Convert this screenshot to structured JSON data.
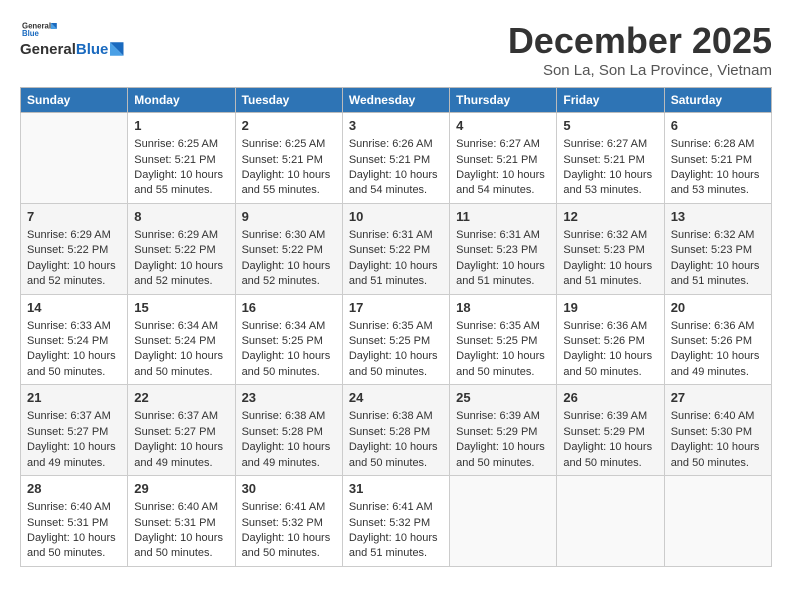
{
  "header": {
    "logo_general": "General",
    "logo_blue": "Blue",
    "month_title": "December 2025",
    "location": "Son La, Son La Province, Vietnam"
  },
  "weekdays": [
    "Sunday",
    "Monday",
    "Tuesday",
    "Wednesday",
    "Thursday",
    "Friday",
    "Saturday"
  ],
  "weeks": [
    [
      {
        "day": "",
        "sunrise": "",
        "sunset": "",
        "daylight": ""
      },
      {
        "day": "1",
        "sunrise": "Sunrise: 6:25 AM",
        "sunset": "Sunset: 5:21 PM",
        "daylight": "Daylight: 10 hours and 55 minutes."
      },
      {
        "day": "2",
        "sunrise": "Sunrise: 6:25 AM",
        "sunset": "Sunset: 5:21 PM",
        "daylight": "Daylight: 10 hours and 55 minutes."
      },
      {
        "day": "3",
        "sunrise": "Sunrise: 6:26 AM",
        "sunset": "Sunset: 5:21 PM",
        "daylight": "Daylight: 10 hours and 54 minutes."
      },
      {
        "day": "4",
        "sunrise": "Sunrise: 6:27 AM",
        "sunset": "Sunset: 5:21 PM",
        "daylight": "Daylight: 10 hours and 54 minutes."
      },
      {
        "day": "5",
        "sunrise": "Sunrise: 6:27 AM",
        "sunset": "Sunset: 5:21 PM",
        "daylight": "Daylight: 10 hours and 53 minutes."
      },
      {
        "day": "6",
        "sunrise": "Sunrise: 6:28 AM",
        "sunset": "Sunset: 5:21 PM",
        "daylight": "Daylight: 10 hours and 53 minutes."
      }
    ],
    [
      {
        "day": "7",
        "sunrise": "Sunrise: 6:29 AM",
        "sunset": "Sunset: 5:22 PM",
        "daylight": "Daylight: 10 hours and 52 minutes."
      },
      {
        "day": "8",
        "sunrise": "Sunrise: 6:29 AM",
        "sunset": "Sunset: 5:22 PM",
        "daylight": "Daylight: 10 hours and 52 minutes."
      },
      {
        "day": "9",
        "sunrise": "Sunrise: 6:30 AM",
        "sunset": "Sunset: 5:22 PM",
        "daylight": "Daylight: 10 hours and 52 minutes."
      },
      {
        "day": "10",
        "sunrise": "Sunrise: 6:31 AM",
        "sunset": "Sunset: 5:22 PM",
        "daylight": "Daylight: 10 hours and 51 minutes."
      },
      {
        "day": "11",
        "sunrise": "Sunrise: 6:31 AM",
        "sunset": "Sunset: 5:23 PM",
        "daylight": "Daylight: 10 hours and 51 minutes."
      },
      {
        "day": "12",
        "sunrise": "Sunrise: 6:32 AM",
        "sunset": "Sunset: 5:23 PM",
        "daylight": "Daylight: 10 hours and 51 minutes."
      },
      {
        "day": "13",
        "sunrise": "Sunrise: 6:32 AM",
        "sunset": "Sunset: 5:23 PM",
        "daylight": "Daylight: 10 hours and 51 minutes."
      }
    ],
    [
      {
        "day": "14",
        "sunrise": "Sunrise: 6:33 AM",
        "sunset": "Sunset: 5:24 PM",
        "daylight": "Daylight: 10 hours and 50 minutes."
      },
      {
        "day": "15",
        "sunrise": "Sunrise: 6:34 AM",
        "sunset": "Sunset: 5:24 PM",
        "daylight": "Daylight: 10 hours and 50 minutes."
      },
      {
        "day": "16",
        "sunrise": "Sunrise: 6:34 AM",
        "sunset": "Sunset: 5:25 PM",
        "daylight": "Daylight: 10 hours and 50 minutes."
      },
      {
        "day": "17",
        "sunrise": "Sunrise: 6:35 AM",
        "sunset": "Sunset: 5:25 PM",
        "daylight": "Daylight: 10 hours and 50 minutes."
      },
      {
        "day": "18",
        "sunrise": "Sunrise: 6:35 AM",
        "sunset": "Sunset: 5:25 PM",
        "daylight": "Daylight: 10 hours and 50 minutes."
      },
      {
        "day": "19",
        "sunrise": "Sunrise: 6:36 AM",
        "sunset": "Sunset: 5:26 PM",
        "daylight": "Daylight: 10 hours and 50 minutes."
      },
      {
        "day": "20",
        "sunrise": "Sunrise: 6:36 AM",
        "sunset": "Sunset: 5:26 PM",
        "daylight": "Daylight: 10 hours and 49 minutes."
      }
    ],
    [
      {
        "day": "21",
        "sunrise": "Sunrise: 6:37 AM",
        "sunset": "Sunset: 5:27 PM",
        "daylight": "Daylight: 10 hours and 49 minutes."
      },
      {
        "day": "22",
        "sunrise": "Sunrise: 6:37 AM",
        "sunset": "Sunset: 5:27 PM",
        "daylight": "Daylight: 10 hours and 49 minutes."
      },
      {
        "day": "23",
        "sunrise": "Sunrise: 6:38 AM",
        "sunset": "Sunset: 5:28 PM",
        "daylight": "Daylight: 10 hours and 49 minutes."
      },
      {
        "day": "24",
        "sunrise": "Sunrise: 6:38 AM",
        "sunset": "Sunset: 5:28 PM",
        "daylight": "Daylight: 10 hours and 50 minutes."
      },
      {
        "day": "25",
        "sunrise": "Sunrise: 6:39 AM",
        "sunset": "Sunset: 5:29 PM",
        "daylight": "Daylight: 10 hours and 50 minutes."
      },
      {
        "day": "26",
        "sunrise": "Sunrise: 6:39 AM",
        "sunset": "Sunset: 5:29 PM",
        "daylight": "Daylight: 10 hours and 50 minutes."
      },
      {
        "day": "27",
        "sunrise": "Sunrise: 6:40 AM",
        "sunset": "Sunset: 5:30 PM",
        "daylight": "Daylight: 10 hours and 50 minutes."
      }
    ],
    [
      {
        "day": "28",
        "sunrise": "Sunrise: 6:40 AM",
        "sunset": "Sunset: 5:31 PM",
        "daylight": "Daylight: 10 hours and 50 minutes."
      },
      {
        "day": "29",
        "sunrise": "Sunrise: 6:40 AM",
        "sunset": "Sunset: 5:31 PM",
        "daylight": "Daylight: 10 hours and 50 minutes."
      },
      {
        "day": "30",
        "sunrise": "Sunrise: 6:41 AM",
        "sunset": "Sunset: 5:32 PM",
        "daylight": "Daylight: 10 hours and 50 minutes."
      },
      {
        "day": "31",
        "sunrise": "Sunrise: 6:41 AM",
        "sunset": "Sunset: 5:32 PM",
        "daylight": "Daylight: 10 hours and 51 minutes."
      },
      {
        "day": "",
        "sunrise": "",
        "sunset": "",
        "daylight": ""
      },
      {
        "day": "",
        "sunrise": "",
        "sunset": "",
        "daylight": ""
      },
      {
        "day": "",
        "sunrise": "",
        "sunset": "",
        "daylight": ""
      }
    ]
  ]
}
